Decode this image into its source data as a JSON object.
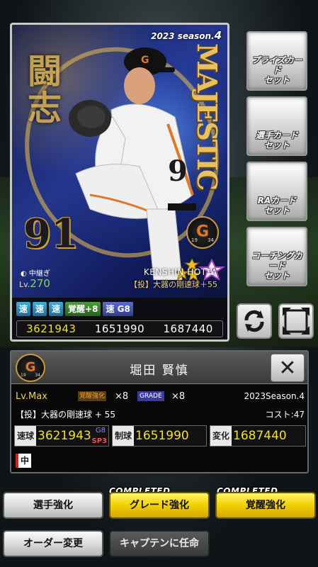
{
  "card": {
    "season_prefix": "2023 season.",
    "season_num": "4",
    "series": "MAJESTIC",
    "brush_text": "闘志",
    "uniform_number": "91",
    "team_badge": {
      "letter": "G",
      "left": "19",
      "right": "34"
    },
    "team_short": "◐ 中継ぎ",
    "level_label": "Lv.",
    "level_value": "270",
    "star_count": "10",
    "player_name_en": "KENSHIN HOTTA",
    "ability": "【投】大器の剛速球＋55",
    "chips": [
      "速",
      "速",
      "速",
      "覚醒+8",
      "速 G8"
    ],
    "stats": [
      "3621943",
      "1651990",
      "1687440"
    ]
  },
  "side_buttons": [
    {
      "label": "プライズカード\nセット"
    },
    {
      "label": "選手カード\nセット"
    },
    {
      "label": "RAカード\nセット"
    },
    {
      "label": "コーチングカード\nセット"
    }
  ],
  "icons": {
    "rotate": "rotate-icon",
    "expand": "expand-icon",
    "close": "close-icon"
  },
  "panel": {
    "name": "堀田 賢慎",
    "lv": "Lv.Max",
    "awaken_tag": "覚醒強化",
    "awaken_x": "×8",
    "grade_tag": "GRADE",
    "grade_x": "×8",
    "season": "2023Season.4",
    "ability": "【投】大器の剛速球 + 55",
    "cost": "コスト:47",
    "stats": [
      {
        "label": "速球",
        "value": "3621943",
        "g8": "G8",
        "sp3": "SP3"
      },
      {
        "label": "制球",
        "value": "1651990"
      },
      {
        "label": "変化",
        "value": "1687440"
      }
    ],
    "position": "中"
  },
  "buttons": {
    "player_enhance": "選手強化",
    "grade_enhance": "グレード強化",
    "awaken_enhance": "覚醒強化",
    "completed": "COMPLETED",
    "order_change": "オーダー変更",
    "captain": "キャプテンに任命"
  },
  "colors": {
    "gold": "#f2d000",
    "stat_yellow": "#f0e030",
    "card_blue": "#24358a"
  }
}
